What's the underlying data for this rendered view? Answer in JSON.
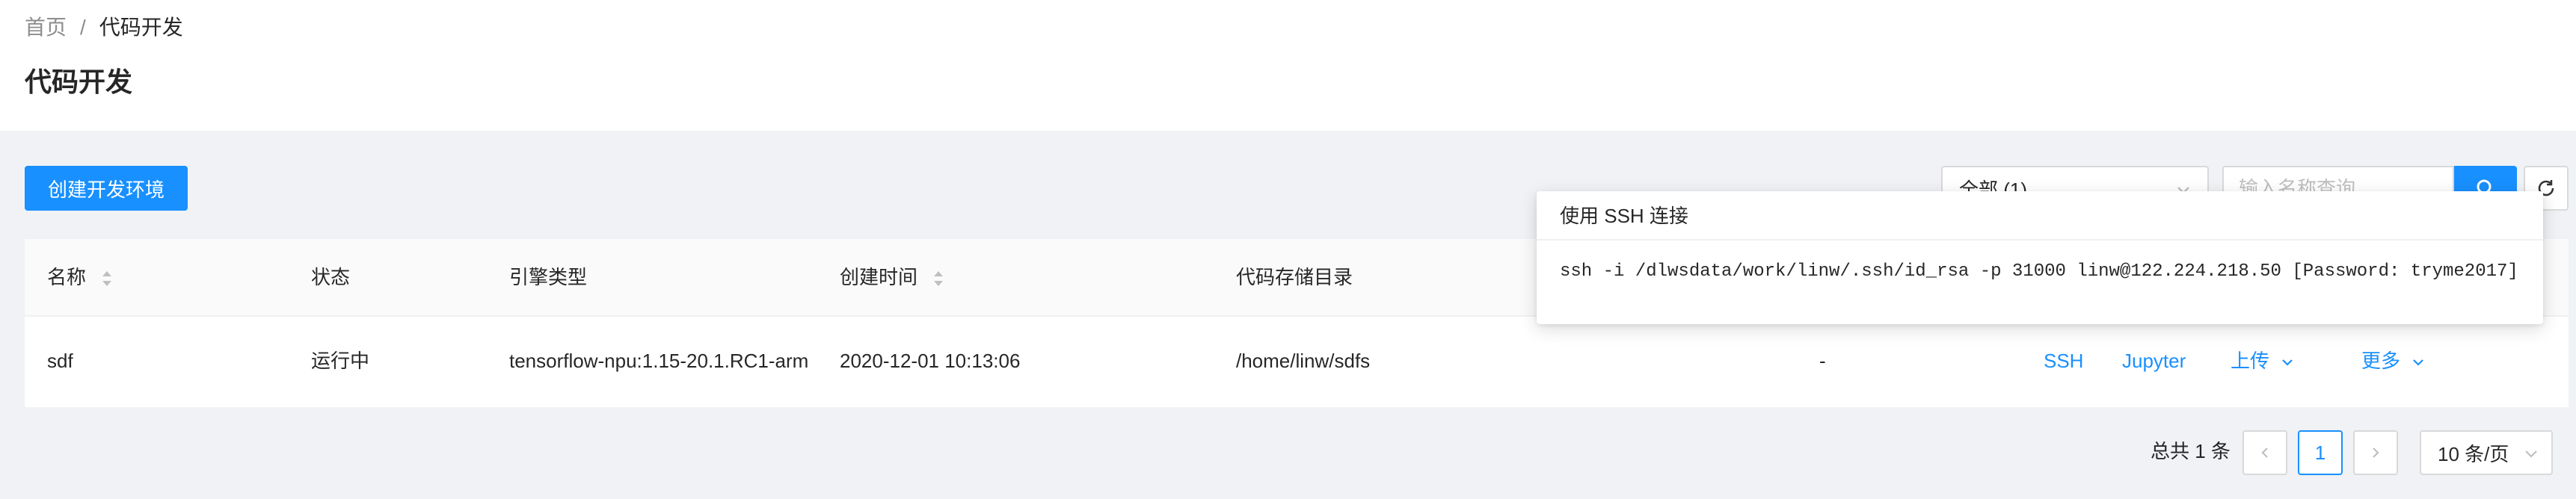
{
  "breadcrumb": {
    "home": "首页",
    "separator": "/",
    "current": "代码开发"
  },
  "page_title": "代码开发",
  "toolbar": {
    "create_button": "创建开发环境",
    "filter_select_value": "全部 (1)",
    "search_placeholder": "输入名称查询"
  },
  "table": {
    "columns": [
      "名称",
      "状态",
      "引擎类型",
      "创建时间",
      "代码存储目录"
    ],
    "rows": [
      {
        "name": "sdf",
        "status": "运行中",
        "engine": "tensorflow-npu:1.15-20.1.RC1-arm",
        "created": "2020-12-01 10:13:06",
        "dir": "/home/linw/sdfs",
        "extra": "-",
        "actions": {
          "ssh": "SSH",
          "jupyter": "Jupyter",
          "upload": "上传",
          "more": "更多"
        }
      }
    ]
  },
  "popover": {
    "title": "使用 SSH 连接",
    "command": "ssh -i /dlwsdata/work/linw/.ssh/id_rsa -p 31000 linw@122.224.218.50 [Password: tryme2017]"
  },
  "pagination": {
    "total": "总共 1 条",
    "current_page": "1",
    "page_size": "10 条/页"
  },
  "colors": {
    "primary": "#1890ff",
    "background": "#f0f2f5"
  },
  "icons": [
    "sort-icon",
    "chevron-down-icon",
    "search-icon",
    "refresh-icon",
    "chevron-left-icon",
    "chevron-right-icon"
  ]
}
